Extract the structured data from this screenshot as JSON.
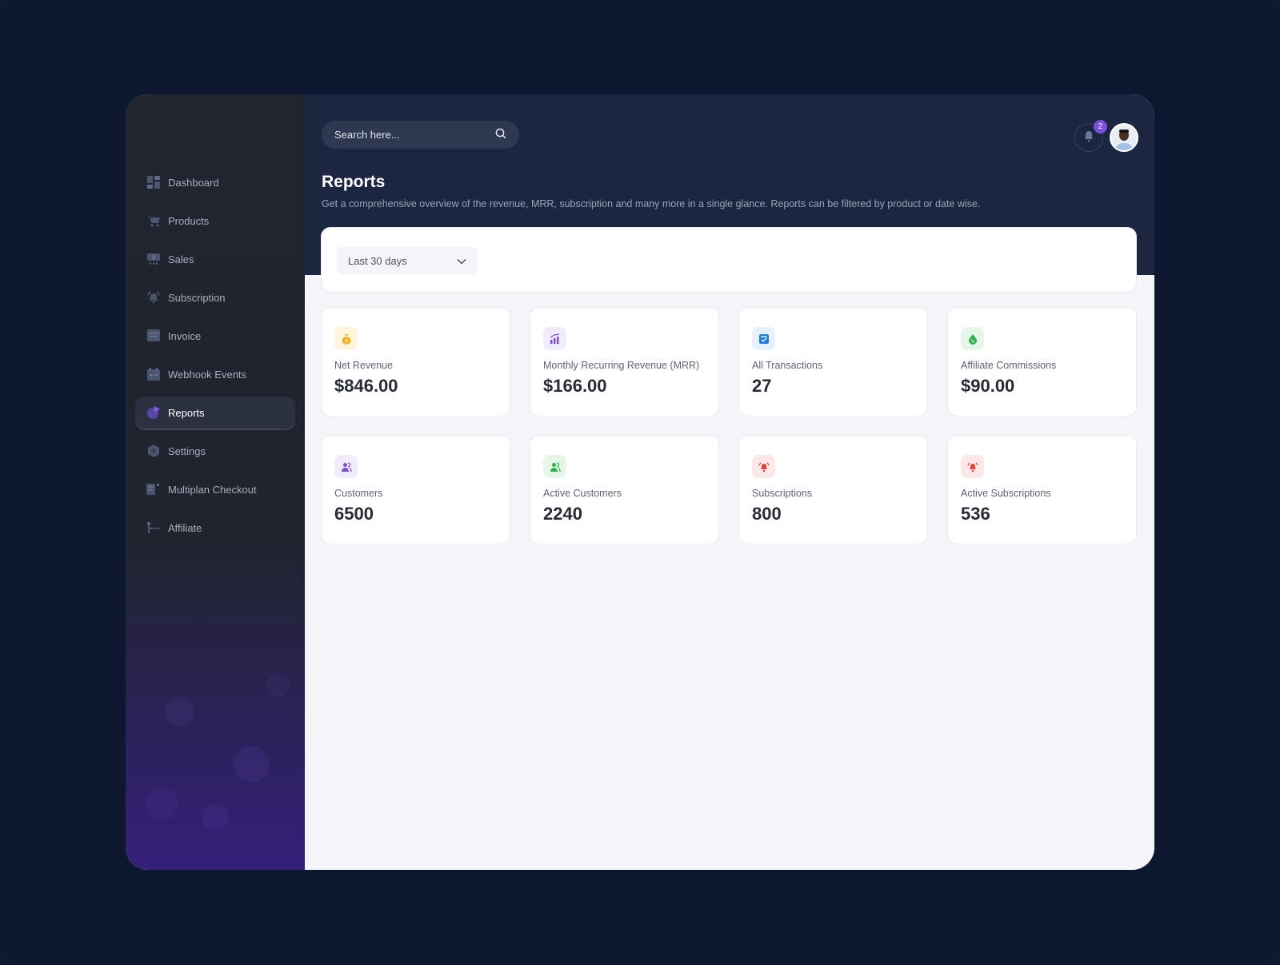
{
  "sidebar": {
    "items": [
      {
        "label": "Dashboard",
        "icon": "dashboard-icon",
        "active": false
      },
      {
        "label": "Products",
        "icon": "cart-icon",
        "active": false
      },
      {
        "label": "Sales",
        "icon": "sales-icon",
        "active": false
      },
      {
        "label": "Subscription",
        "icon": "bell-icon",
        "active": false
      },
      {
        "label": "Invoice",
        "icon": "invoice-icon",
        "active": false
      },
      {
        "label": "Webhook Events",
        "icon": "calendar-icon",
        "active": false
      },
      {
        "label": "Reports",
        "icon": "pie-chart-icon",
        "active": true
      },
      {
        "label": "Settings",
        "icon": "gear-icon",
        "active": false
      },
      {
        "label": "Multiplan Checkout",
        "icon": "checkout-icon",
        "active": false
      },
      {
        "label": "Affiliate",
        "icon": "affiliate-icon",
        "active": false
      }
    ]
  },
  "header": {
    "search_placeholder": "Search here...",
    "notification_count": "2"
  },
  "page": {
    "title": "Reports",
    "description": "Get a comprehensive overview of the revenue, MRR, subscription and many more in a single glance. Reports can be filtered by product or date wise."
  },
  "filter": {
    "date_range": "Last 30 days"
  },
  "stats": [
    {
      "label": "Net Revenue",
      "value": "$846.00",
      "icon": "money-bag-icon",
      "color": "#f2b01e",
      "bg": "#fff4dc"
    },
    {
      "label": "Monthly Recurring Revenue (MRR)",
      "value": "$166.00",
      "icon": "bar-chart-icon",
      "color": "#7a4fd0",
      "bg": "#f1ecfb"
    },
    {
      "label": "All Transactions",
      "value": "27",
      "icon": "transactions-icon",
      "color": "#1e7ee0",
      "bg": "#e6f1fc"
    },
    {
      "label": "Affiliate Commissions",
      "value": "$90.00",
      "icon": "commission-icon",
      "color": "#2bb14a",
      "bg": "#e6f7e9"
    },
    {
      "label": "Customers",
      "value": "6500",
      "icon": "users-icon",
      "color": "#7a4fd0",
      "bg": "#f1ecfb"
    },
    {
      "label": "Active Customers",
      "value": "2240",
      "icon": "users-icon",
      "color": "#2bb14a",
      "bg": "#e6f7e9"
    },
    {
      "label": "Subscriptions",
      "value": "800",
      "icon": "alarm-bell-icon",
      "color": "#ea3b3b",
      "bg": "#fce8e8"
    },
    {
      "label": "Active Subscriptions",
      "value": "536",
      "icon": "alarm-bell-icon",
      "color": "#ea3b3b",
      "bg": "#fce8e8"
    }
  ]
}
